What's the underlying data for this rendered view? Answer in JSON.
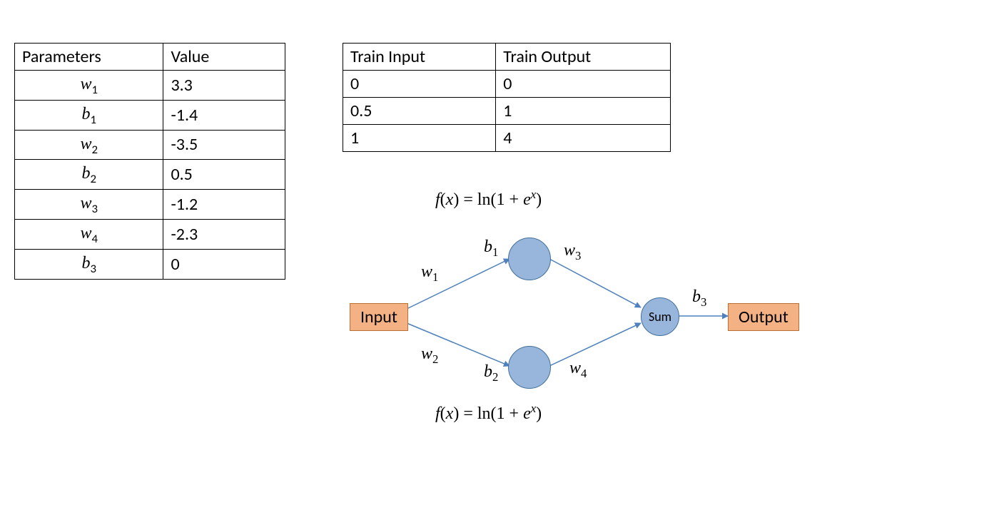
{
  "params_table": {
    "headers": [
      "Parameters",
      "Value"
    ],
    "rows": [
      {
        "param_base": "w",
        "param_sub": "1",
        "value": "3.3"
      },
      {
        "param_base": "b",
        "param_sub": "1",
        "value": "-1.4"
      },
      {
        "param_base": "w",
        "param_sub": "2",
        "value": "-3.5"
      },
      {
        "param_base": "b",
        "param_sub": "2",
        "value": "0.5"
      },
      {
        "param_base": "w",
        "param_sub": "3",
        "value": "-1.2"
      },
      {
        "param_base": "w",
        "param_sub": "4",
        "value": "-2.3"
      },
      {
        "param_base": "b",
        "param_sub": "3",
        "value": "0"
      }
    ]
  },
  "train_table": {
    "headers": [
      "Train Input",
      "Train Output"
    ],
    "rows": [
      {
        "in": "0",
        "out": "0"
      },
      {
        "in": "0.5",
        "out": "1"
      },
      {
        "in": "1",
        "out": "4"
      }
    ]
  },
  "diagram": {
    "activation_top": "f(x) = ln(1 + eˣ)",
    "activation_bottom": "f(x) = ln(1 + eˣ)",
    "input_label": "Input",
    "output_label": "Output",
    "sum_label": "Sum",
    "w1": "w",
    "w1s": "1",
    "w2": "w",
    "w2s": "2",
    "w3": "w",
    "w3s": "3",
    "w4": "w",
    "w4s": "4",
    "b1": "b",
    "b1s": "1",
    "b2": "b",
    "b2s": "2",
    "b3": "b",
    "b3s": "3"
  }
}
